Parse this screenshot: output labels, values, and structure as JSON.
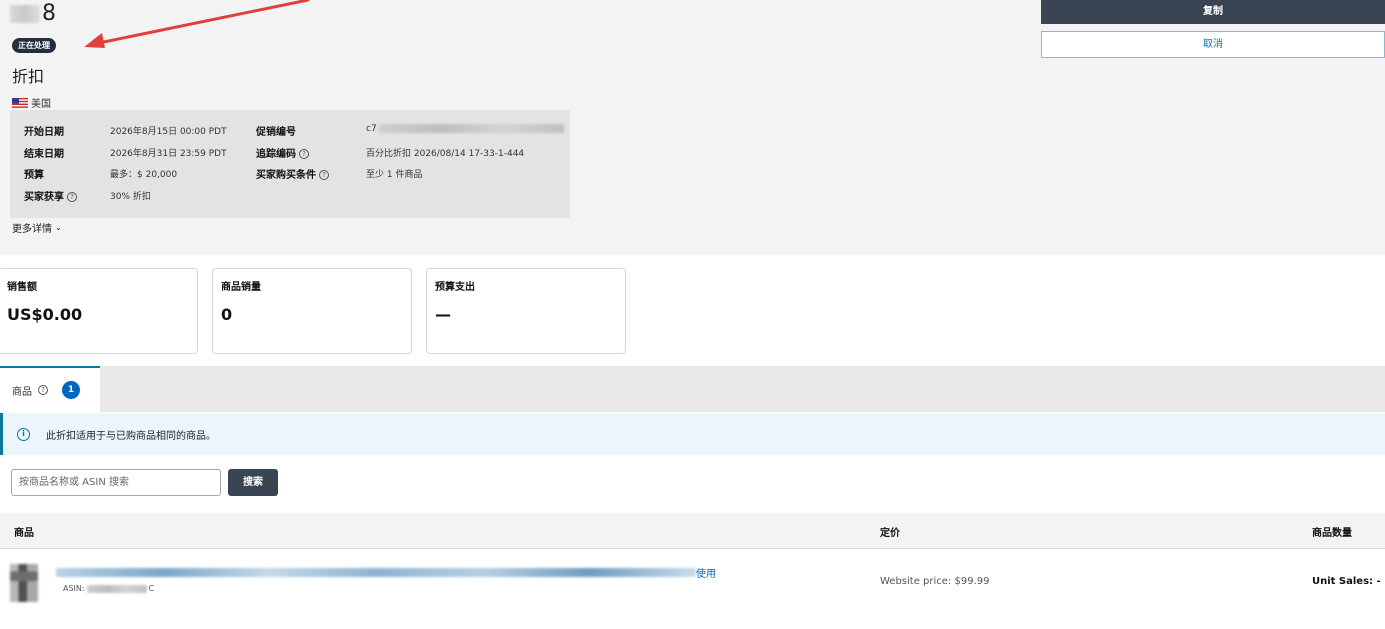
{
  "header": {
    "title_suffix": "8",
    "status": "正在处理",
    "promo_type": "折扣",
    "country": "美国"
  },
  "actions": {
    "copy_label": "复制",
    "cancel_label": "取消"
  },
  "details": {
    "start_date_label": "开始日期",
    "start_date_value": "2026年8月15日 00:00 PDT",
    "end_date_label": "结束日期",
    "end_date_value": "2026年8月31日 23:59 PDT",
    "budget_label": "预算",
    "budget_value": "最多：$ 20,000",
    "buyer_gets_label": "买家获享",
    "buyer_gets_value": "30% 折扣",
    "promo_id_label": "促销编号",
    "promo_id_value": "c7",
    "tracking_label": "追踪编码",
    "tracking_value": "百分比折扣 2026/08/14 17-33-1-444",
    "purchase_condition_label": "买家购买条件",
    "purchase_condition_value": "至少 1 件商品"
  },
  "more_details_label": "更多详情",
  "metrics": [
    {
      "label": "销售额",
      "value": "US$0.00"
    },
    {
      "label": "商品销量",
      "value": "0"
    },
    {
      "label": "预算支出",
      "value": "—"
    }
  ],
  "tabs": {
    "products_label": "商品",
    "products_count": "1"
  },
  "info_banner": "此折扣适用于与已购商品相同的商品。",
  "search": {
    "placeholder": "按商品名称或 ASIN 搜索",
    "button_label": "搜索"
  },
  "table": {
    "columns": [
      "商品",
      "定价",
      "商品数量"
    ],
    "rows": [
      {
        "product_tail": "使用",
        "asin_label": "ASIN:",
        "asin_suffix": "C",
        "price": "Website price: $99.99",
        "units": "Unit Sales: -"
      }
    ]
  },
  "colors": {
    "dark_button": "#3a4553",
    "accent_teal": "#0a7a9c",
    "badge_blue": "#0066c0",
    "arrow_red": "#e0403c"
  }
}
